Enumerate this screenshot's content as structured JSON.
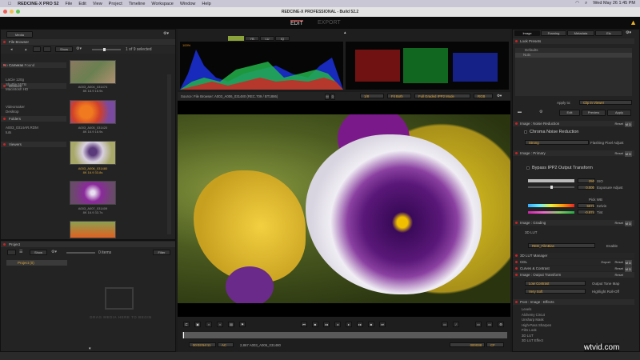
{
  "menubar": {
    "app": "REDCINE-X PRO 52",
    "items": [
      "File",
      "Edit",
      "View",
      "Project",
      "Timeline",
      "Workspace",
      "Window",
      "Help"
    ],
    "clock": "Wed May 26  1:45 PM"
  },
  "window": {
    "title": "REDCINE-X PROFESSIONAL - Build 52.2"
  },
  "modes": {
    "edit": "EDIT",
    "export": "EXPORT"
  },
  "left": {
    "media_tab": "Media",
    "file_browser": "File Browser",
    "show": "Show",
    "selection": "1 of 9 selected",
    "cameras": {
      "label": "Cameras",
      "empty": "No Cameras Found"
    },
    "devices": {
      "label": "Devices",
      "items": [
        "LaCie 120g",
        "Shuttle 55TB",
        "Macintosh HD"
      ]
    },
    "folders": {
      "label": "Folders",
      "items": [
        "Videomaker",
        "Desktop"
      ]
    },
    "viewers": {
      "label": "Viewers",
      "items": [
        "A003_0314AR.RDM",
        "tuts"
      ]
    },
    "clips": [
      {
        "name": "A003_A004_031474",
        "meta": "8K 16.9   16.9s",
        "selected": false
      },
      {
        "name": "A003_A005_031420",
        "meta": "8K 16.9   16.9s",
        "selected": false
      },
      {
        "name": "A003_A006_031480",
        "meta": "8K 16.9   33.8s",
        "selected": true
      },
      {
        "name": "A003_A007_031409",
        "meta": "8K 16.9   33.7s",
        "selected": false
      }
    ],
    "project": {
      "label": "Project",
      "show": "Show",
      "count": "0 items",
      "filter": "Filter",
      "folder": "Project (0)",
      "drop_hint": "DRAG MEDIA HERE TO BEGIN"
    }
  },
  "scopes": {
    "tabs": [
      "YB",
      "LU",
      "IQ"
    ],
    "hist_label": "100%"
  },
  "source_bar": {
    "source": "Source: File Browser: A003_A006_031480 (REC.709 / BT1886)",
    "m": "M",
    "d": "D",
    "zoom": "1/8",
    "fit": "Fit Both",
    "mode": "Full Graded IPP2 Mode",
    "channel": "RGB"
  },
  "transport": {
    "timecode": "00:03:54:11",
    "audio": "AC",
    "clip": "2,867 A003_A006_031480",
    "duration": "000038",
    "cf": "CF"
  },
  "right": {
    "tabs": [
      "Image",
      "Framing",
      "Metadata",
      "Etc"
    ],
    "look_presets": {
      "label": "Look Presets",
      "defaults": "Defaults",
      "item": "Nuts",
      "apply_to_label": "Apply to:",
      "apply_to": "Clip in Viewer",
      "edit": "Edit",
      "preview": "Preview",
      "apply": "Apply"
    },
    "noise": {
      "label": "Image : Noise Reduction",
      "chroma": "Chroma Noise Reduction",
      "strength": "Strong",
      "flash": "Flashing Pixel Adjust"
    },
    "primary": {
      "label": "Image : Primary",
      "bypass": "Bypass IPP2 Output Transform",
      "iso_val": "250",
      "iso": "ISO",
      "exp_val": "0.000",
      "exp": "Exposure Adjust",
      "pick_wb": "Pick WB",
      "kelvin_val": "5571",
      "kelvin": "Kelvin",
      "tint_val": "-0.874",
      "tint": "Tint"
    },
    "grading": {
      "label": "Image : Grading",
      "lut3d": "3D LUT",
      "lut_val": "RED_FilmBias",
      "enable": "Enable",
      "lut_mgr": "3D LUT Manager",
      "cdl": "CDL",
      "export": "Export",
      "curves": "Curves & Contrast"
    },
    "output": {
      "label": "Image : Output Transform",
      "contrast": "Low Contrast",
      "tone": "Output Tone Map",
      "soft": "Very Soft",
      "rolloff": "Highlight Roll-Off"
    },
    "effects": {
      "label": "Post : Image : Effects",
      "items": [
        "Levels",
        "Alchemy Circut",
        "Unsharp Mask",
        "High-Pass Sharpen",
        "Film Look",
        "3D LUT",
        "3D LUT Effect"
      ]
    },
    "reset": "Reset"
  },
  "watermark": "wtvid.com"
}
